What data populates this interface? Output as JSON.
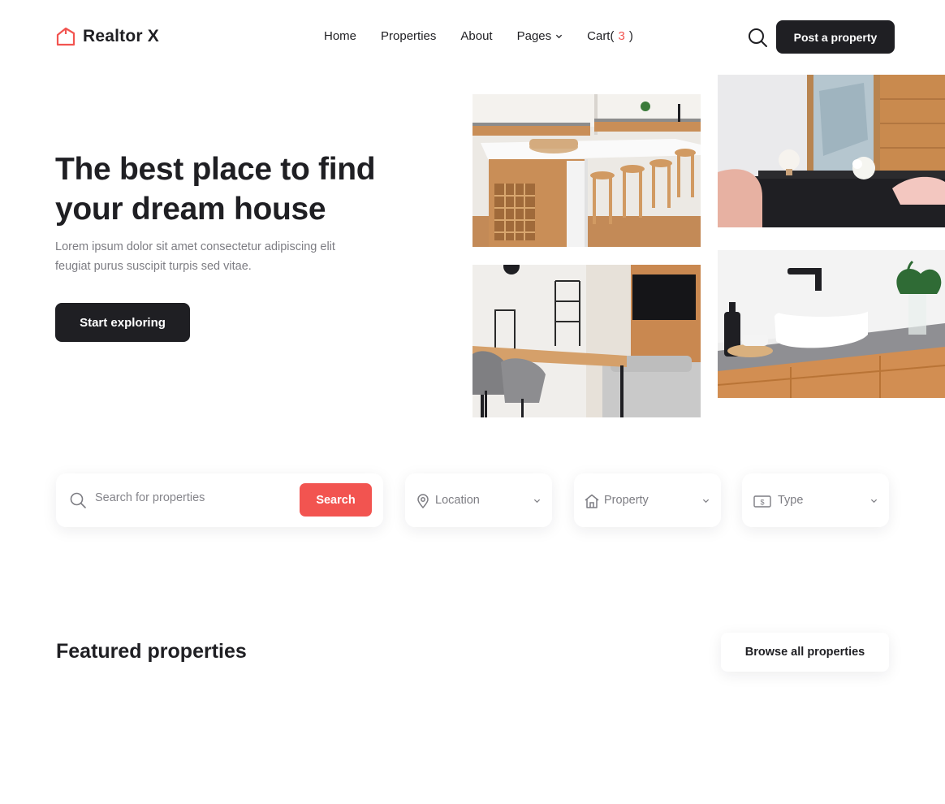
{
  "brand": {
    "name": "Realtor X",
    "accent": "#f25450",
    "dark": "#1f1f23"
  },
  "nav": {
    "items": [
      {
        "label": "Home"
      },
      {
        "label": "Properties"
      },
      {
        "label": "About"
      },
      {
        "label": "Pages"
      },
      {
        "label": "Cart(",
        "count": "3",
        "suffix": ")"
      }
    ]
  },
  "header": {
    "post_label": "Post a property",
    "search_icon": "search-icon"
  },
  "hero": {
    "title": "The best place to find your dream house",
    "subtitle": "Lorem ipsum dolor sit amet consectetur adipiscing elit feugiat purus suscipit turpis sed vitae.",
    "cta_label": "Start exploring",
    "images": [
      {
        "name": "kitchen-photo"
      },
      {
        "name": "living-decor-photo"
      },
      {
        "name": "dining-room-photo"
      },
      {
        "name": "bathroom-photo"
      }
    ]
  },
  "search": {
    "placeholder": "Search for properties",
    "button_label": "Search",
    "filters": [
      {
        "label": "Location",
        "icon": "location-pin-icon"
      },
      {
        "label": "Property",
        "icon": "house-icon"
      },
      {
        "label": "Type",
        "icon": "dollar-bill-icon"
      }
    ]
  },
  "featured": {
    "title": "Featured properties",
    "browse_label": "Browse all properties"
  }
}
